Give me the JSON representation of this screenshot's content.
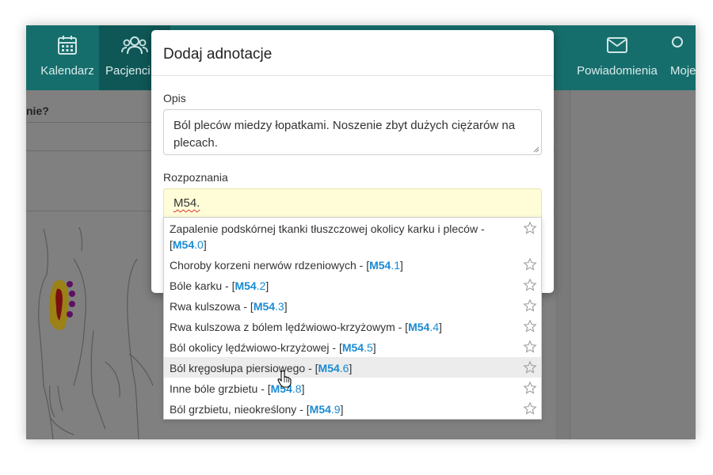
{
  "nav": {
    "items": [
      {
        "label": "Kalendarz",
        "icon": "calendar-icon"
      },
      {
        "label": "Pacjenci",
        "icon": "users-icon"
      },
      {
        "label": "Powiadomienia",
        "icon": "envelope-icon"
      },
      {
        "label": "Moje",
        "icon": "user-icon"
      }
    ]
  },
  "background": {
    "question_fragment": "nie?"
  },
  "modal": {
    "title": "Dodaj adnotacje",
    "description_label": "Opis",
    "description_value_line1": "Ból pleców miedzy łopatkami. Noszenie zbyt dużych ciężarów na",
    "description_value_line2": "plecach.",
    "diagnosis_label": "Rozpoznania",
    "diagnosis_value": "M54."
  },
  "suggestions": [
    {
      "text": "Zapalenie podskórnej tkanki tłuszczowej okolicy karku i pleców -",
      "code": "M54",
      "sub": ".0",
      "multiline": true
    },
    {
      "text": "Choroby korzeni nerwów rdzeniowych -",
      "code": "M54",
      "sub": ".1"
    },
    {
      "text": "Bóle karku -",
      "code": "M54",
      "sub": ".2"
    },
    {
      "text": "Rwa kulszowa -",
      "code": "M54",
      "sub": ".3"
    },
    {
      "text": "Rwa kulszowa z bólem lędźwiowo-krzyżowym -",
      "code": "M54",
      "sub": ".4"
    },
    {
      "text": "Ból okolicy lędźwiowo-krzyżowej -",
      "code": "M54",
      "sub": ".5"
    },
    {
      "text": "Ból kręgosłupa piersiowego -",
      "code": "M54",
      "sub": ".6",
      "hovered": true
    },
    {
      "text": "Inne bóle grzbietu -",
      "code": "M54",
      "sub": ".8"
    },
    {
      "text": "Ból grzbietu, nieokreślony -",
      "code": "M54",
      "sub": ".9"
    }
  ],
  "colors": {
    "nav_bg": "#166e6c",
    "code_link": "#1a8ad4",
    "input_highlight": "#fffdd7"
  }
}
